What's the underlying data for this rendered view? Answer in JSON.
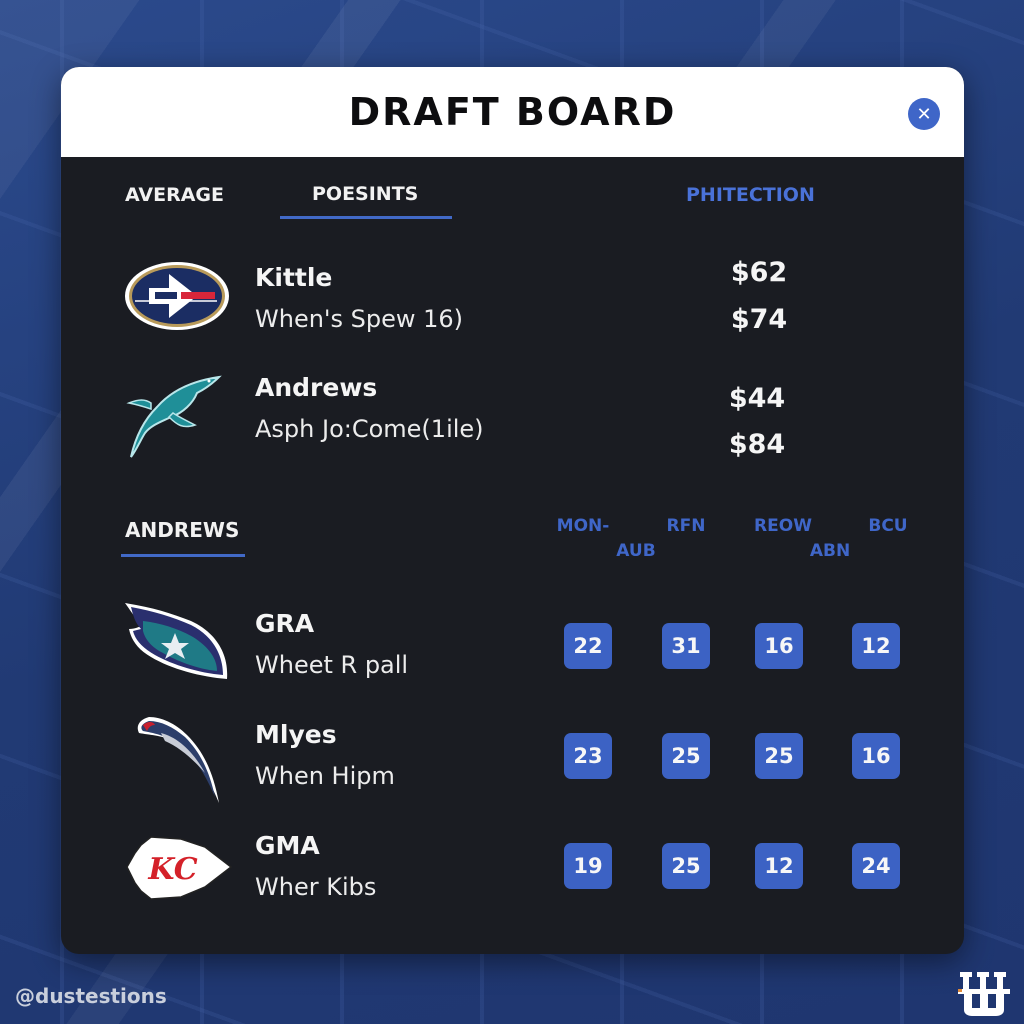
{
  "header": {
    "title": "DRAFT BOARD",
    "close_icon": "close-icon"
  },
  "tabs": [
    {
      "label": "AVERAGE",
      "active": false
    },
    {
      "label": "POESINTS",
      "active": true
    },
    {
      "label": "PHITECTION",
      "active": false
    }
  ],
  "top_players": [
    {
      "name": "Kittle",
      "subtitle": "When's Spew 16)",
      "logo": "oval-arrow-logo-icon",
      "prices": [
        "$62",
        "$74"
      ]
    },
    {
      "name": "Andrews",
      "subtitle": "Asph Jo:Come(1ile)",
      "logo": "dolphin-logo-icon",
      "prices": [
        "$44",
        "$84"
      ]
    }
  ],
  "section": {
    "label": "ANDREWS",
    "columns": [
      {
        "line1": "MON-",
        "line2": "AUB"
      },
      {
        "line1": "RFN",
        "line2": ""
      },
      {
        "line1": "REOW",
        "line2": "ABN"
      },
      {
        "line1": "BCU",
        "line2": ""
      }
    ]
  },
  "rows": [
    {
      "name": "GRA",
      "subtitle": "Wheet R pall",
      "logo": "flame-shield-logo-icon",
      "values": [
        "22",
        "31",
        "16",
        "12"
      ]
    },
    {
      "name": "Mlyes",
      "subtitle": "When Hipm",
      "logo": "feather-logo-icon",
      "values": [
        "23",
        "25",
        "25",
        "16"
      ]
    },
    {
      "name": "GMA",
      "subtitle": "Wher Kibs",
      "logo": "kc-arrowhead-logo-icon",
      "values": [
        "19",
        "25",
        "12",
        "24"
      ]
    }
  ],
  "footer": {
    "handle": "@dustestions",
    "brand_icon": "w-brand-logo-icon"
  },
  "colors": {
    "accent": "#3f66c8",
    "card_bg": "#1a1c22",
    "header_bg": "#ffffff",
    "page_bg": "#243f7a"
  }
}
